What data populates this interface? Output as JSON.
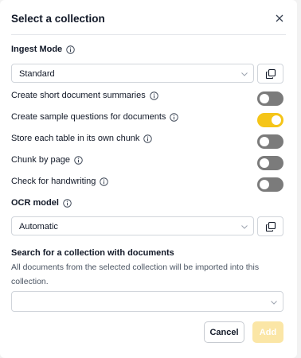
{
  "dialog": {
    "title": "Select a collection"
  },
  "ingest_mode": {
    "label": "Ingest Mode",
    "value": "Standard"
  },
  "toggles": [
    {
      "label": "Create short document summaries",
      "on": false
    },
    {
      "label": "Create sample questions for documents",
      "on": true
    },
    {
      "label": "Store each table in its own chunk",
      "on": false
    },
    {
      "label": "Chunk by page",
      "on": false
    },
    {
      "label": "Check for handwriting",
      "on": false
    }
  ],
  "ocr_model": {
    "label": "OCR model",
    "value": "Automatic"
  },
  "search": {
    "label": "Search for a collection with documents",
    "description": "All documents from the selected collection will be imported into this collection.",
    "value": ""
  },
  "actions": {
    "cancel_label": "Cancel",
    "add_label": "Add"
  },
  "colors": {
    "toggle_on": "#f5c518",
    "toggle_off": "#7b7b7b",
    "add_disabled": "#fbe6a6"
  }
}
